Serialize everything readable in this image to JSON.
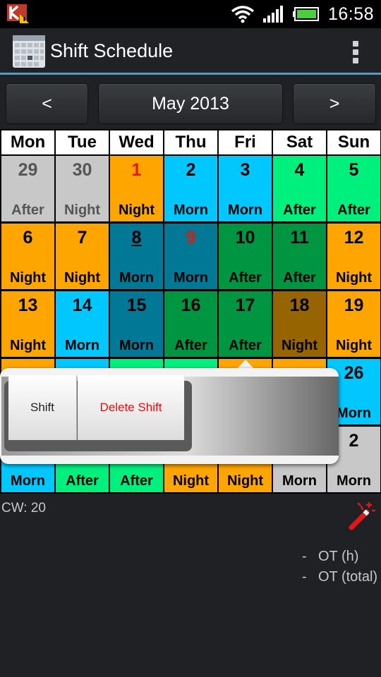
{
  "status_bar": {
    "time": "16:58",
    "icons": [
      "kaspersky-warning-icon",
      "wifi-icon",
      "signal-icon",
      "battery-icon"
    ]
  },
  "action_bar": {
    "title": "Shift Schedule",
    "app_icon": "calendar-app-icon",
    "overflow_icon": "overflow-menu-icon",
    "accent_color": "#3aa4d8"
  },
  "nav": {
    "prev_label": "<",
    "month_label": "May 2013",
    "next_label": ">"
  },
  "calendar": {
    "weekdays": [
      "Mon",
      "Tue",
      "Wed",
      "Thu",
      "Fri",
      "Sat",
      "Sun"
    ],
    "shift_colors": {
      "After_other_month": "#c8c8c8",
      "Night": "#ffa500",
      "Morn_light": "#00c8ff",
      "Morn_dark": "#007896",
      "After_light": "#00f07d",
      "After_dark": "#009641",
      "Night_dark": "#966400"
    },
    "weeks": [
      [
        {
          "day": "29",
          "shift": "After",
          "bg": "#c8c8c8",
          "dim": true
        },
        {
          "day": "30",
          "shift": "Night",
          "bg": "#c8c8c8",
          "dim": true
        },
        {
          "day": "1",
          "shift": "Night",
          "bg": "#ffa500",
          "red": true
        },
        {
          "day": "2",
          "shift": "Morn",
          "bg": "#00c8ff"
        },
        {
          "day": "3",
          "shift": "Morn",
          "bg": "#00c8ff"
        },
        {
          "day": "4",
          "shift": "After",
          "bg": "#00f07d"
        },
        {
          "day": "5",
          "shift": "After",
          "bg": "#00f07d"
        }
      ],
      [
        {
          "day": "6",
          "shift": "Night",
          "bg": "#ffa500"
        },
        {
          "day": "7",
          "shift": "Night",
          "bg": "#ffa500"
        },
        {
          "day": "8",
          "shift": "Morn",
          "bg": "#007896",
          "underline": true
        },
        {
          "day": "9",
          "shift": "Morn",
          "bg": "#007896",
          "red": true
        },
        {
          "day": "10",
          "shift": "After",
          "bg": "#009641"
        },
        {
          "day": "11",
          "shift": "After",
          "bg": "#009641"
        },
        {
          "day": "12",
          "shift": "Night",
          "bg": "#ffa500"
        }
      ],
      [
        {
          "day": "13",
          "shift": "Night",
          "bg": "#ffa500"
        },
        {
          "day": "14",
          "shift": "Morn",
          "bg": "#00c8ff"
        },
        {
          "day": "15",
          "shift": "Morn",
          "bg": "#007896"
        },
        {
          "day": "16",
          "shift": "After",
          "bg": "#009641"
        },
        {
          "day": "17",
          "shift": "After",
          "bg": "#009641"
        },
        {
          "day": "18",
          "shift": "Night",
          "bg": "#966400"
        },
        {
          "day": "19",
          "shift": "Night",
          "bg": "#ffa500"
        }
      ],
      [
        {
          "day": "",
          "shift": "",
          "bg": "#ffa500"
        },
        {
          "day": "",
          "shift": "",
          "bg": "#00c8ff"
        },
        {
          "day": "",
          "shift": "",
          "bg": "#00f07d"
        },
        {
          "day": "",
          "shift": "",
          "bg": "#00f07d"
        },
        {
          "day": "",
          "shift": "",
          "bg": "#ffa500"
        },
        {
          "day": "",
          "shift": "",
          "bg": "#ffa500"
        },
        {
          "day": "26",
          "shift": "Morn",
          "bg": "#00c8ff"
        }
      ],
      [
        {
          "day": "",
          "shift": "Morn",
          "bg": "#00c8ff"
        },
        {
          "day": "",
          "shift": "After",
          "bg": "#00f07d"
        },
        {
          "day": "",
          "shift": "After",
          "bg": "#00f07d"
        },
        {
          "day": "",
          "shift": "Night",
          "bg": "#ffa500"
        },
        {
          "day": "",
          "shift": "Night",
          "bg": "#ffa500"
        },
        {
          "day": "",
          "shift": "Morn",
          "bg": "#c8c8c8"
        },
        {
          "day": "2",
          "shift": "Morn",
          "bg": "#c8c8c8"
        }
      ]
    ]
  },
  "popup": {
    "shift_label": "Shift",
    "delete_label": "Delete Shift"
  },
  "footer": {
    "cw_label": "CW: 20",
    "wand_icon": "magic-wand-icon",
    "ot_rows": [
      {
        "dash": "-",
        "label": "OT (h)"
      },
      {
        "dash": "-",
        "label": "OT (total)"
      }
    ]
  }
}
